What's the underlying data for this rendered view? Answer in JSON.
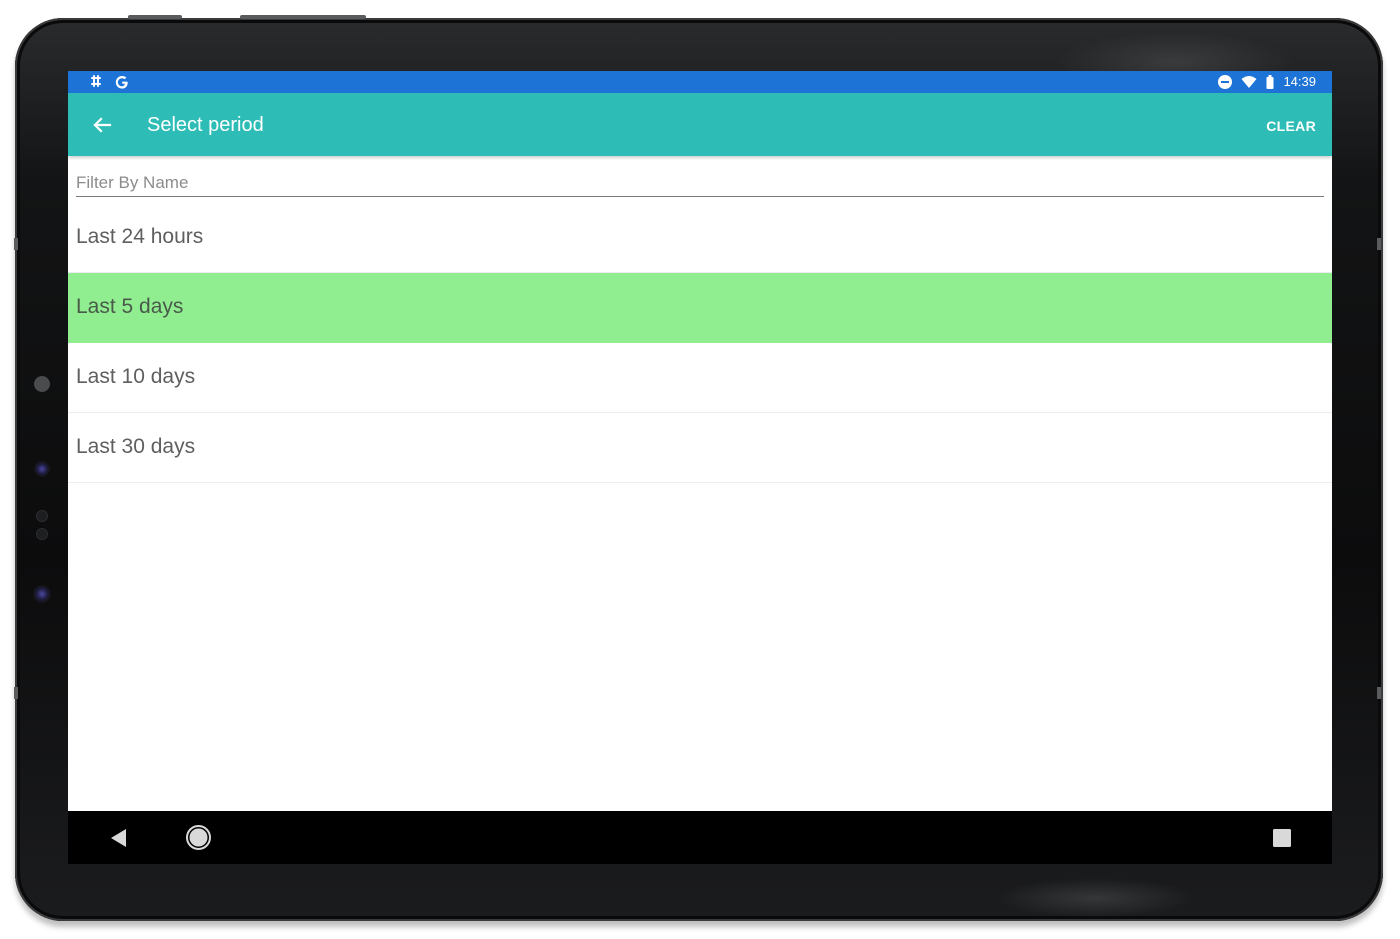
{
  "status_bar": {
    "left_icons": [
      "slack-icon",
      "google-icon"
    ],
    "right_icons": [
      "do-not-disturb-icon",
      "wifi-icon",
      "battery-icon"
    ],
    "time": "14:39"
  },
  "app_bar": {
    "title": "Select period",
    "clear_label": "CLEAR",
    "back_icon": "arrow-left-icon"
  },
  "filter": {
    "placeholder": "Filter By Name",
    "value": ""
  },
  "periods": [
    {
      "label": "Last 24 hours",
      "selected": false
    },
    {
      "label": "Last 5 days",
      "selected": true
    },
    {
      "label": "Last 10 days",
      "selected": false
    },
    {
      "label": "Last 30 days",
      "selected": false
    }
  ],
  "colors": {
    "status_bar": "#1e74d6",
    "app_bar": "#2ebdb6",
    "selected_row": "#90ee90",
    "nav_bar": "#000000"
  },
  "nav_bar": {
    "buttons": [
      "back-triangle-icon",
      "home-circle-icon",
      "recents-square-icon"
    ]
  }
}
